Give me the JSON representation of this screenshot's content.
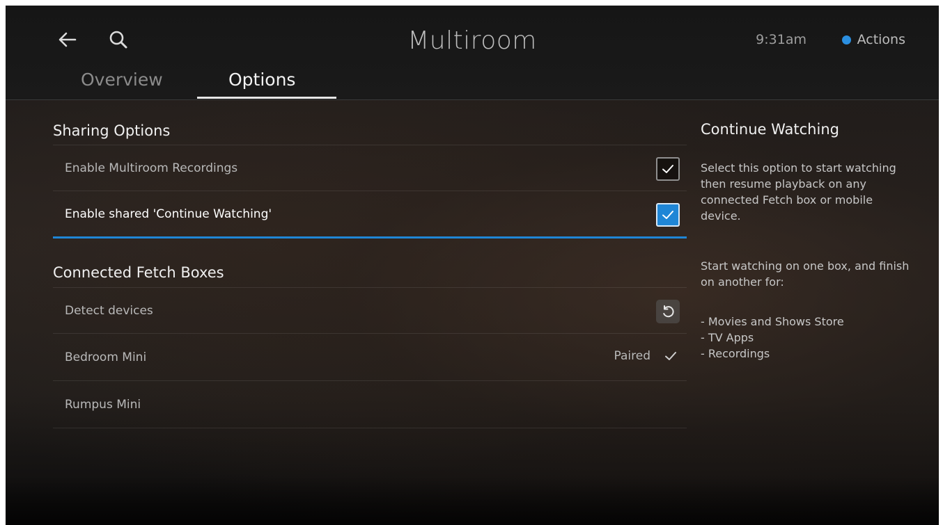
{
  "header": {
    "title": "Multiroom",
    "time": "9:31am",
    "actions_label": "Actions",
    "accent_color": "#1f86d6",
    "tabs": [
      {
        "label": "Overview",
        "selected": false
      },
      {
        "label": "Options",
        "selected": true
      }
    ]
  },
  "sharing": {
    "title": "Sharing Options",
    "items": [
      {
        "label": "Enable Multiroom Recordings",
        "checked": true
      },
      {
        "label": "Enable shared 'Continue Watching'",
        "checked": true,
        "focused": true
      }
    ]
  },
  "boxes": {
    "title": "Connected Fetch Boxes",
    "detect_label": "Detect devices",
    "items": [
      {
        "label": "Bedroom Mini",
        "status": "Paired"
      },
      {
        "label": "Rumpus Mini",
        "status": ""
      }
    ]
  },
  "info": {
    "title": "Continue Watching",
    "para1": "Select this option to start watching then resume playback on any connected Fetch box or mobile device.",
    "para2": "Start watching on one box, and finish on another for:",
    "list": [
      "- Movies and Shows Store",
      "- TV Apps",
      "- Recordings"
    ]
  },
  "icons": [
    "back-arrow-icon",
    "search-icon",
    "checkmark-icon",
    "refresh-icon"
  ]
}
